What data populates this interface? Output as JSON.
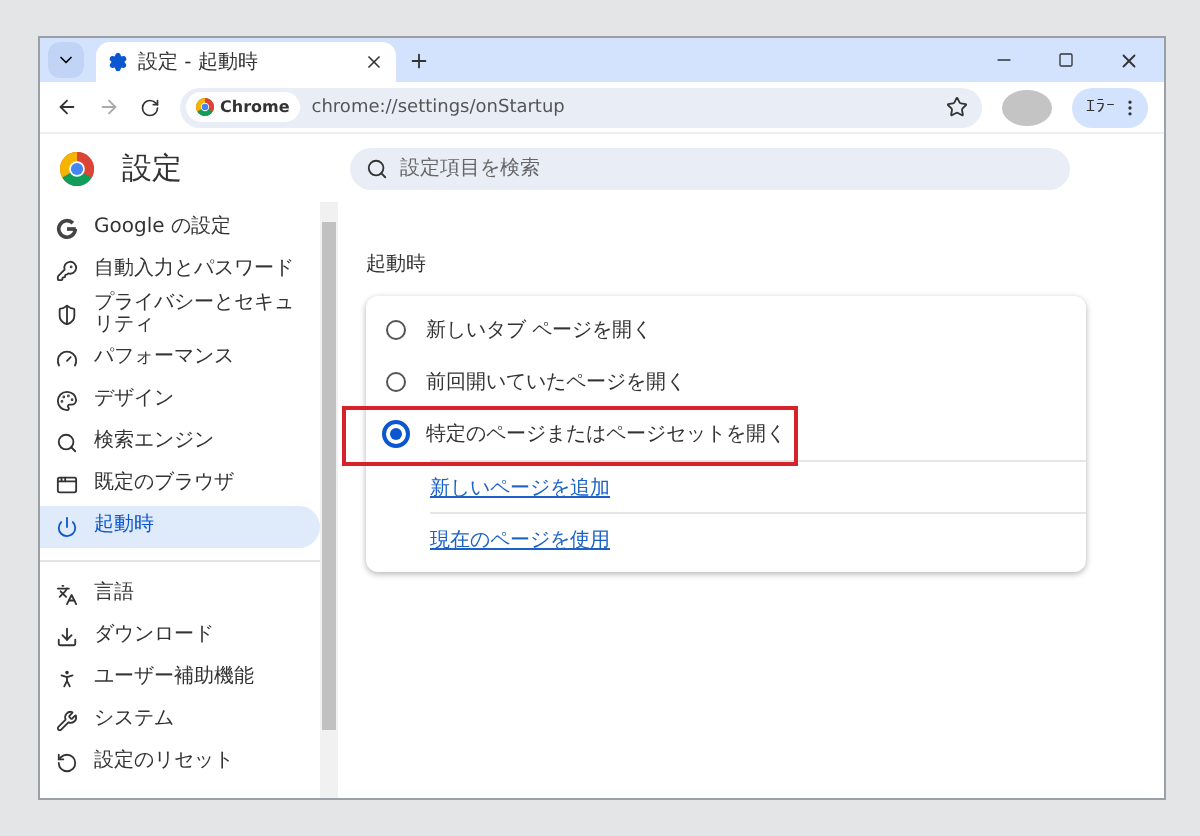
{
  "tab": {
    "title": "設定 - 起動時"
  },
  "address_bar": {
    "chip": "Chrome",
    "url": "chrome://settings/onStartup"
  },
  "profile_button": {
    "label": "ｴﾗｰ"
  },
  "header": {
    "title": "設定",
    "search": {
      "placeholder": "設定項目を検索"
    }
  },
  "sidebar": {
    "items": [
      {
        "kind": "google",
        "label": "Google の設定",
        "selected": false
      },
      {
        "kind": "key",
        "label": "自動入力とパスワード",
        "selected": false
      },
      {
        "kind": "shield",
        "label": "プライバシーとセキュリティ",
        "selected": false
      },
      {
        "kind": "gauge",
        "label": "パフォーマンス",
        "selected": false
      },
      {
        "kind": "palette",
        "label": "デザイン",
        "selected": false
      },
      {
        "kind": "search",
        "label": "検索エンジン",
        "selected": false
      },
      {
        "kind": "browser",
        "label": "既定のブラウザ",
        "selected": false
      },
      {
        "kind": "power",
        "label": "起動時",
        "selected": true
      },
      {
        "kind": "divider"
      },
      {
        "kind": "language",
        "label": "言語",
        "selected": false
      },
      {
        "kind": "download",
        "label": "ダウンロード",
        "selected": false
      },
      {
        "kind": "accessibility",
        "label": "ユーザー補助機能",
        "selected": false
      },
      {
        "kind": "wrench",
        "label": "システム",
        "selected": false
      },
      {
        "kind": "reset",
        "label": "設定のリセット",
        "selected": false
      }
    ]
  },
  "section": {
    "title": "起動時",
    "options": [
      {
        "label": "新しいタブ ページを開く",
        "selected": false,
        "highlighted": false
      },
      {
        "label": "前回開いていたページを開く",
        "selected": false,
        "highlighted": false
      },
      {
        "label": "特定のページまたはページセットを開く",
        "selected": true,
        "highlighted": true
      }
    ],
    "links": [
      "新しいページを追加",
      "現在のページを使用"
    ]
  }
}
